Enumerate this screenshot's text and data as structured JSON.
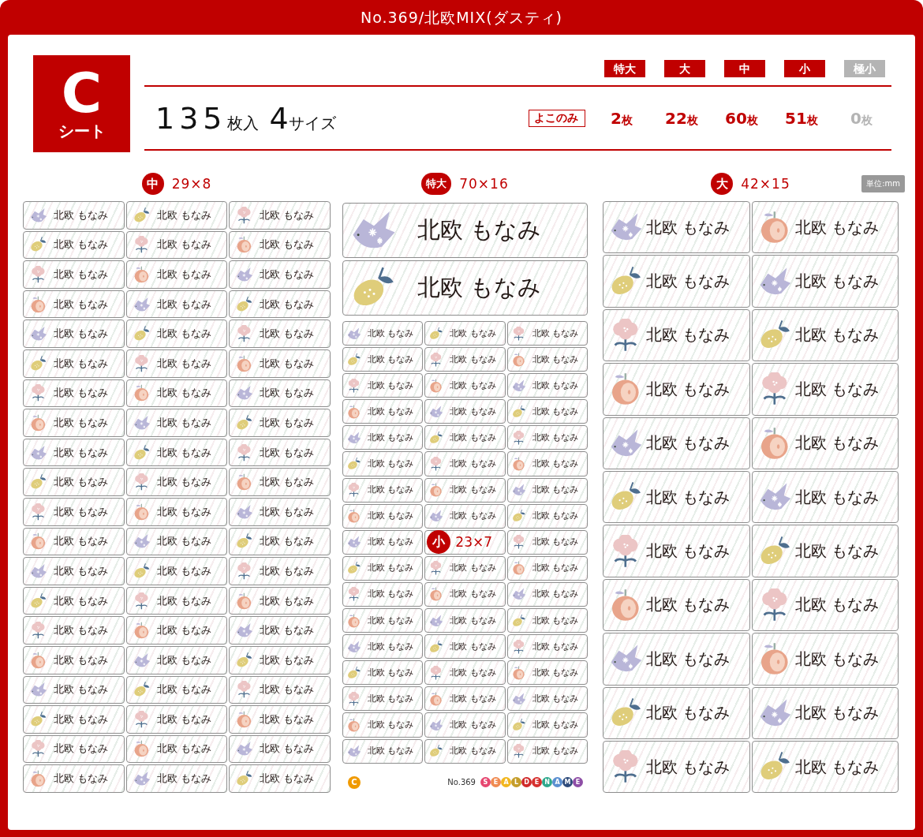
{
  "title": "No.369/北欧MIX(ダスティ)",
  "sheet": {
    "letter": "C",
    "label": "シート"
  },
  "summary": {
    "count": "135",
    "count_unit": "枚入",
    "sizes": "4",
    "sizes_unit": "サイズ"
  },
  "orientation_tag": "よこのみ",
  "sizes": [
    {
      "name": "特大",
      "count": "2",
      "unit": "枚",
      "disabled": false
    },
    {
      "name": "大",
      "count": "22",
      "unit": "枚",
      "disabled": false
    },
    {
      "name": "中",
      "count": "60",
      "unit": "枚",
      "disabled": false
    },
    {
      "name": "小",
      "count": "51",
      "unit": "枚",
      "disabled": false
    },
    {
      "name": "極小",
      "count": "0",
      "unit": "枚",
      "disabled": true
    }
  ],
  "medium": {
    "badge": "中",
    "dimensions": "29×8",
    "labels": [
      "北欧 もなみ",
      "北欧 もなみ",
      "北欧 もなみ",
      "北欧 もなみ",
      "北欧 もなみ",
      "北欧 もなみ",
      "北欧 もなみ",
      "北欧 もなみ",
      "北欧 もなみ",
      "北欧 もなみ",
      "北欧 もなみ",
      "北欧 もなみ",
      "北欧 もなみ",
      "北欧 もなみ",
      "北欧 もなみ",
      "北欧 もなみ",
      "北欧 もなみ",
      "北欧 もなみ",
      "北欧 もなみ",
      "北欧 もなみ",
      "北欧 もなみ",
      "北欧 もなみ",
      "北欧 もなみ",
      "北欧 もなみ",
      "北欧 もなみ",
      "北欧 もなみ",
      "北欧 もなみ",
      "北欧 もなみ",
      "北欧 もなみ",
      "北欧 もなみ",
      "北欧 もなみ",
      "北欧 もなみ",
      "北欧 もなみ",
      "北欧 もなみ",
      "北欧 もなみ",
      "北欧 もなみ",
      "北欧 もなみ",
      "北欧 もなみ",
      "北欧 もなみ",
      "北欧 もなみ",
      "北欧 もなみ",
      "北欧 もなみ",
      "北欧 もなみ",
      "北欧 もなみ",
      "北欧 もなみ",
      "北欧 もなみ",
      "北欧 もなみ",
      "北欧 もなみ",
      "北欧 もなみ",
      "北欧 もなみ",
      "北欧 もなみ",
      "北欧 もなみ",
      "北欧 もなみ",
      "北欧 もなみ",
      "北欧 もなみ",
      "北欧 もなみ",
      "北欧 もなみ",
      "北欧 もなみ",
      "北欧 もなみ",
      "北欧 もなみ"
    ]
  },
  "extra_large": {
    "badge": "特大",
    "dimensions": "70×16",
    "labels": [
      "北欧 もなみ",
      "北欧 もなみ"
    ]
  },
  "small": {
    "items": [
      {
        "kind": "label",
        "text": "北欧 もなみ"
      },
      {
        "kind": "label",
        "text": "北欧 もなみ"
      },
      {
        "kind": "label",
        "text": "北欧 もなみ"
      },
      {
        "kind": "label",
        "text": "北欧 もなみ"
      },
      {
        "kind": "label",
        "text": "北欧 もなみ"
      },
      {
        "kind": "label",
        "text": "北欧 もなみ"
      },
      {
        "kind": "label",
        "text": "北欧 もなみ"
      },
      {
        "kind": "label",
        "text": "北欧 もなみ"
      },
      {
        "kind": "label",
        "text": "北欧 もなみ"
      },
      {
        "kind": "label",
        "text": "北欧 もなみ"
      },
      {
        "kind": "label",
        "text": "北欧 もなみ"
      },
      {
        "kind": "label",
        "text": "北欧 もなみ"
      },
      {
        "kind": "label",
        "text": "北欧 もなみ"
      },
      {
        "kind": "label",
        "text": "北欧 もなみ"
      },
      {
        "kind": "label",
        "text": "北欧 もなみ"
      },
      {
        "kind": "label",
        "text": "北欧 もなみ"
      },
      {
        "kind": "label",
        "text": "北欧 もなみ"
      },
      {
        "kind": "label",
        "text": "北欧 もなみ"
      },
      {
        "kind": "label",
        "text": "北欧 もなみ"
      },
      {
        "kind": "label",
        "text": "北欧 もなみ"
      },
      {
        "kind": "label",
        "text": "北欧 もなみ"
      },
      {
        "kind": "label",
        "text": "北欧 もなみ"
      },
      {
        "kind": "label",
        "text": "北欧 もなみ"
      },
      {
        "kind": "label",
        "text": "北欧 もなみ"
      },
      {
        "kind": "label",
        "text": "北欧 もなみ"
      },
      {
        "kind": "caption",
        "badge": "小",
        "dimensions": "23×7"
      },
      {
        "kind": "label",
        "text": "北欧 もなみ"
      },
      {
        "kind": "label",
        "text": "北欧 もなみ"
      },
      {
        "kind": "label",
        "text": "北欧 もなみ"
      },
      {
        "kind": "label",
        "text": "北欧 もなみ"
      },
      {
        "kind": "label",
        "text": "北欧 もなみ"
      },
      {
        "kind": "label",
        "text": "北欧 もなみ"
      },
      {
        "kind": "label",
        "text": "北欧 もなみ"
      },
      {
        "kind": "label",
        "text": "北欧 もなみ"
      },
      {
        "kind": "label",
        "text": "北欧 もなみ"
      },
      {
        "kind": "label",
        "text": "北欧 もなみ"
      },
      {
        "kind": "label",
        "text": "北欧 もなみ"
      },
      {
        "kind": "label",
        "text": "北欧 もなみ"
      },
      {
        "kind": "label",
        "text": "北欧 もなみ"
      },
      {
        "kind": "label",
        "text": "北欧 もなみ"
      },
      {
        "kind": "label",
        "text": "北欧 もなみ"
      },
      {
        "kind": "label",
        "text": "北欧 もなみ"
      },
      {
        "kind": "label",
        "text": "北欧 もなみ"
      },
      {
        "kind": "label",
        "text": "北欧 もなみ"
      },
      {
        "kind": "label",
        "text": "北欧 もなみ"
      },
      {
        "kind": "label",
        "text": "北欧 もなみ"
      },
      {
        "kind": "label",
        "text": "北欧 もなみ"
      },
      {
        "kind": "label",
        "text": "北欧 もなみ"
      },
      {
        "kind": "label",
        "text": "北欧 もなみ"
      },
      {
        "kind": "label",
        "text": "北欧 もなみ"
      },
      {
        "kind": "label",
        "text": "北欧 もなみ"
      }
    ]
  },
  "large": {
    "badge": "大",
    "dimensions": "42×15",
    "unit_note": "単位:mm",
    "labels": [
      "北欧 もなみ",
      "北欧 もなみ",
      "北欧 もなみ",
      "北欧 もなみ",
      "北欧 もなみ",
      "北欧 もなみ",
      "北欧 もなみ",
      "北欧 もなみ",
      "北欧 もなみ",
      "北欧 もなみ",
      "北欧 もなみ",
      "北欧 もなみ",
      "北欧 もなみ",
      "北欧 もなみ",
      "北欧 もなみ",
      "北欧 もなみ",
      "北欧 もなみ",
      "北欧 もなみ",
      "北欧 もなみ",
      "北欧 もなみ",
      "北欧 もなみ",
      "北欧 もなみ"
    ]
  },
  "footer": {
    "mark": "C",
    "number": "No.369",
    "brand": [
      {
        "letter": "S",
        "color": "#e6466f"
      },
      {
        "letter": "E",
        "color": "#f08a50"
      },
      {
        "letter": "A",
        "color": "#f2b61e"
      },
      {
        "letter": "L",
        "color": "#c59d2a"
      },
      {
        "letter": "D",
        "color": "#d02a2a"
      },
      {
        "letter": "E",
        "color": "#d6302e"
      },
      {
        "letter": "N",
        "color": "#2ea88c"
      },
      {
        "letter": "A",
        "color": "#5b8fd0"
      },
      {
        "letter": "M",
        "color": "#2d4a7a"
      },
      {
        "letter": "E",
        "color": "#8e4ea6"
      }
    ]
  }
}
